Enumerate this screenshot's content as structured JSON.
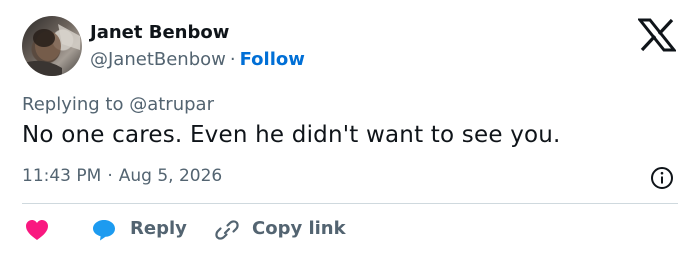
{
  "author": {
    "name": "Janet Benbow",
    "handle": "@JanetBenbow",
    "separator": "·",
    "follow_label": "Follow",
    "avatar_icon": "avatar-photo"
  },
  "brand": {
    "logo_icon": "x-logo-icon"
  },
  "reply_context": {
    "prefix": "Replying to",
    "mention": "@atrupar"
  },
  "tweet": {
    "text": "No one cares. Even he didn't want to see you.",
    "time": "11:43 PM",
    "separator": "·",
    "date": "Aug 5, 2026",
    "info_icon": "info-icon"
  },
  "actions": {
    "like_icon": "heart-icon",
    "reply_icon": "reply-bubble-icon",
    "reply_label": "Reply",
    "copy_icon": "link-icon",
    "copy_label": "Copy link"
  },
  "colors": {
    "text": "#0f1419",
    "secondary": "#536471",
    "follow": "#006fd6",
    "heart": "#f91880",
    "reply_bubble": "#1d9bf0",
    "divider": "#cfd9de"
  }
}
